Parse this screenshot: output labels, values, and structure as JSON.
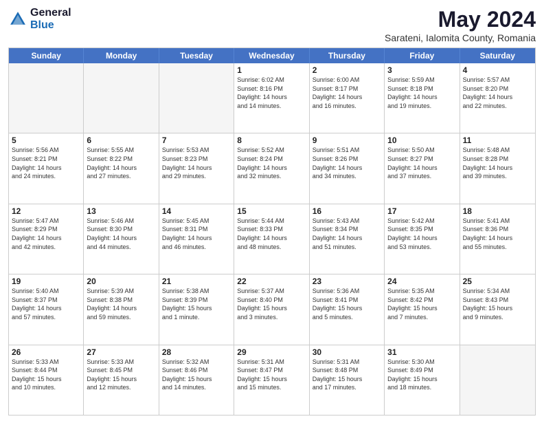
{
  "logo": {
    "general": "General",
    "blue": "Blue"
  },
  "header": {
    "title": "May 2024",
    "subtitle": "Sarateni, Ialomita County, Romania"
  },
  "dayHeaders": [
    "Sunday",
    "Monday",
    "Tuesday",
    "Wednesday",
    "Thursday",
    "Friday",
    "Saturday"
  ],
  "rows": [
    [
      {
        "date": "",
        "empty": true
      },
      {
        "date": "",
        "empty": true
      },
      {
        "date": "",
        "empty": true
      },
      {
        "date": "1",
        "line1": "Sunrise: 6:02 AM",
        "line2": "Sunset: 8:16 PM",
        "line3": "Daylight: 14 hours",
        "line4": "and 14 minutes."
      },
      {
        "date": "2",
        "line1": "Sunrise: 6:00 AM",
        "line2": "Sunset: 8:17 PM",
        "line3": "Daylight: 14 hours",
        "line4": "and 16 minutes."
      },
      {
        "date": "3",
        "line1": "Sunrise: 5:59 AM",
        "line2": "Sunset: 8:18 PM",
        "line3": "Daylight: 14 hours",
        "line4": "and 19 minutes."
      },
      {
        "date": "4",
        "line1": "Sunrise: 5:57 AM",
        "line2": "Sunset: 8:20 PM",
        "line3": "Daylight: 14 hours",
        "line4": "and 22 minutes."
      }
    ],
    [
      {
        "date": "5",
        "line1": "Sunrise: 5:56 AM",
        "line2": "Sunset: 8:21 PM",
        "line3": "Daylight: 14 hours",
        "line4": "and 24 minutes."
      },
      {
        "date": "6",
        "line1": "Sunrise: 5:55 AM",
        "line2": "Sunset: 8:22 PM",
        "line3": "Daylight: 14 hours",
        "line4": "and 27 minutes."
      },
      {
        "date": "7",
        "line1": "Sunrise: 5:53 AM",
        "line2": "Sunset: 8:23 PM",
        "line3": "Daylight: 14 hours",
        "line4": "and 29 minutes."
      },
      {
        "date": "8",
        "line1": "Sunrise: 5:52 AM",
        "line2": "Sunset: 8:24 PM",
        "line3": "Daylight: 14 hours",
        "line4": "and 32 minutes."
      },
      {
        "date": "9",
        "line1": "Sunrise: 5:51 AM",
        "line2": "Sunset: 8:26 PM",
        "line3": "Daylight: 14 hours",
        "line4": "and 34 minutes."
      },
      {
        "date": "10",
        "line1": "Sunrise: 5:50 AM",
        "line2": "Sunset: 8:27 PM",
        "line3": "Daylight: 14 hours",
        "line4": "and 37 minutes."
      },
      {
        "date": "11",
        "line1": "Sunrise: 5:48 AM",
        "line2": "Sunset: 8:28 PM",
        "line3": "Daylight: 14 hours",
        "line4": "and 39 minutes."
      }
    ],
    [
      {
        "date": "12",
        "line1": "Sunrise: 5:47 AM",
        "line2": "Sunset: 8:29 PM",
        "line3": "Daylight: 14 hours",
        "line4": "and 42 minutes."
      },
      {
        "date": "13",
        "line1": "Sunrise: 5:46 AM",
        "line2": "Sunset: 8:30 PM",
        "line3": "Daylight: 14 hours",
        "line4": "and 44 minutes."
      },
      {
        "date": "14",
        "line1": "Sunrise: 5:45 AM",
        "line2": "Sunset: 8:31 PM",
        "line3": "Daylight: 14 hours",
        "line4": "and 46 minutes."
      },
      {
        "date": "15",
        "line1": "Sunrise: 5:44 AM",
        "line2": "Sunset: 8:33 PM",
        "line3": "Daylight: 14 hours",
        "line4": "and 48 minutes."
      },
      {
        "date": "16",
        "line1": "Sunrise: 5:43 AM",
        "line2": "Sunset: 8:34 PM",
        "line3": "Daylight: 14 hours",
        "line4": "and 51 minutes."
      },
      {
        "date": "17",
        "line1": "Sunrise: 5:42 AM",
        "line2": "Sunset: 8:35 PM",
        "line3": "Daylight: 14 hours",
        "line4": "and 53 minutes."
      },
      {
        "date": "18",
        "line1": "Sunrise: 5:41 AM",
        "line2": "Sunset: 8:36 PM",
        "line3": "Daylight: 14 hours",
        "line4": "and 55 minutes."
      }
    ],
    [
      {
        "date": "19",
        "line1": "Sunrise: 5:40 AM",
        "line2": "Sunset: 8:37 PM",
        "line3": "Daylight: 14 hours",
        "line4": "and 57 minutes."
      },
      {
        "date": "20",
        "line1": "Sunrise: 5:39 AM",
        "line2": "Sunset: 8:38 PM",
        "line3": "Daylight: 14 hours",
        "line4": "and 59 minutes."
      },
      {
        "date": "21",
        "line1": "Sunrise: 5:38 AM",
        "line2": "Sunset: 8:39 PM",
        "line3": "Daylight: 15 hours",
        "line4": "and 1 minute."
      },
      {
        "date": "22",
        "line1": "Sunrise: 5:37 AM",
        "line2": "Sunset: 8:40 PM",
        "line3": "Daylight: 15 hours",
        "line4": "and 3 minutes."
      },
      {
        "date": "23",
        "line1": "Sunrise: 5:36 AM",
        "line2": "Sunset: 8:41 PM",
        "line3": "Daylight: 15 hours",
        "line4": "and 5 minutes."
      },
      {
        "date": "24",
        "line1": "Sunrise: 5:35 AM",
        "line2": "Sunset: 8:42 PM",
        "line3": "Daylight: 15 hours",
        "line4": "and 7 minutes."
      },
      {
        "date": "25",
        "line1": "Sunrise: 5:34 AM",
        "line2": "Sunset: 8:43 PM",
        "line3": "Daylight: 15 hours",
        "line4": "and 9 minutes."
      }
    ],
    [
      {
        "date": "26",
        "line1": "Sunrise: 5:33 AM",
        "line2": "Sunset: 8:44 PM",
        "line3": "Daylight: 15 hours",
        "line4": "and 10 minutes."
      },
      {
        "date": "27",
        "line1": "Sunrise: 5:33 AM",
        "line2": "Sunset: 8:45 PM",
        "line3": "Daylight: 15 hours",
        "line4": "and 12 minutes."
      },
      {
        "date": "28",
        "line1": "Sunrise: 5:32 AM",
        "line2": "Sunset: 8:46 PM",
        "line3": "Daylight: 15 hours",
        "line4": "and 14 minutes."
      },
      {
        "date": "29",
        "line1": "Sunrise: 5:31 AM",
        "line2": "Sunset: 8:47 PM",
        "line3": "Daylight: 15 hours",
        "line4": "and 15 minutes."
      },
      {
        "date": "30",
        "line1": "Sunrise: 5:31 AM",
        "line2": "Sunset: 8:48 PM",
        "line3": "Daylight: 15 hours",
        "line4": "and 17 minutes."
      },
      {
        "date": "31",
        "line1": "Sunrise: 5:30 AM",
        "line2": "Sunset: 8:49 PM",
        "line3": "Daylight: 15 hours",
        "line4": "and 18 minutes."
      },
      {
        "date": "",
        "empty": true
      }
    ]
  ]
}
